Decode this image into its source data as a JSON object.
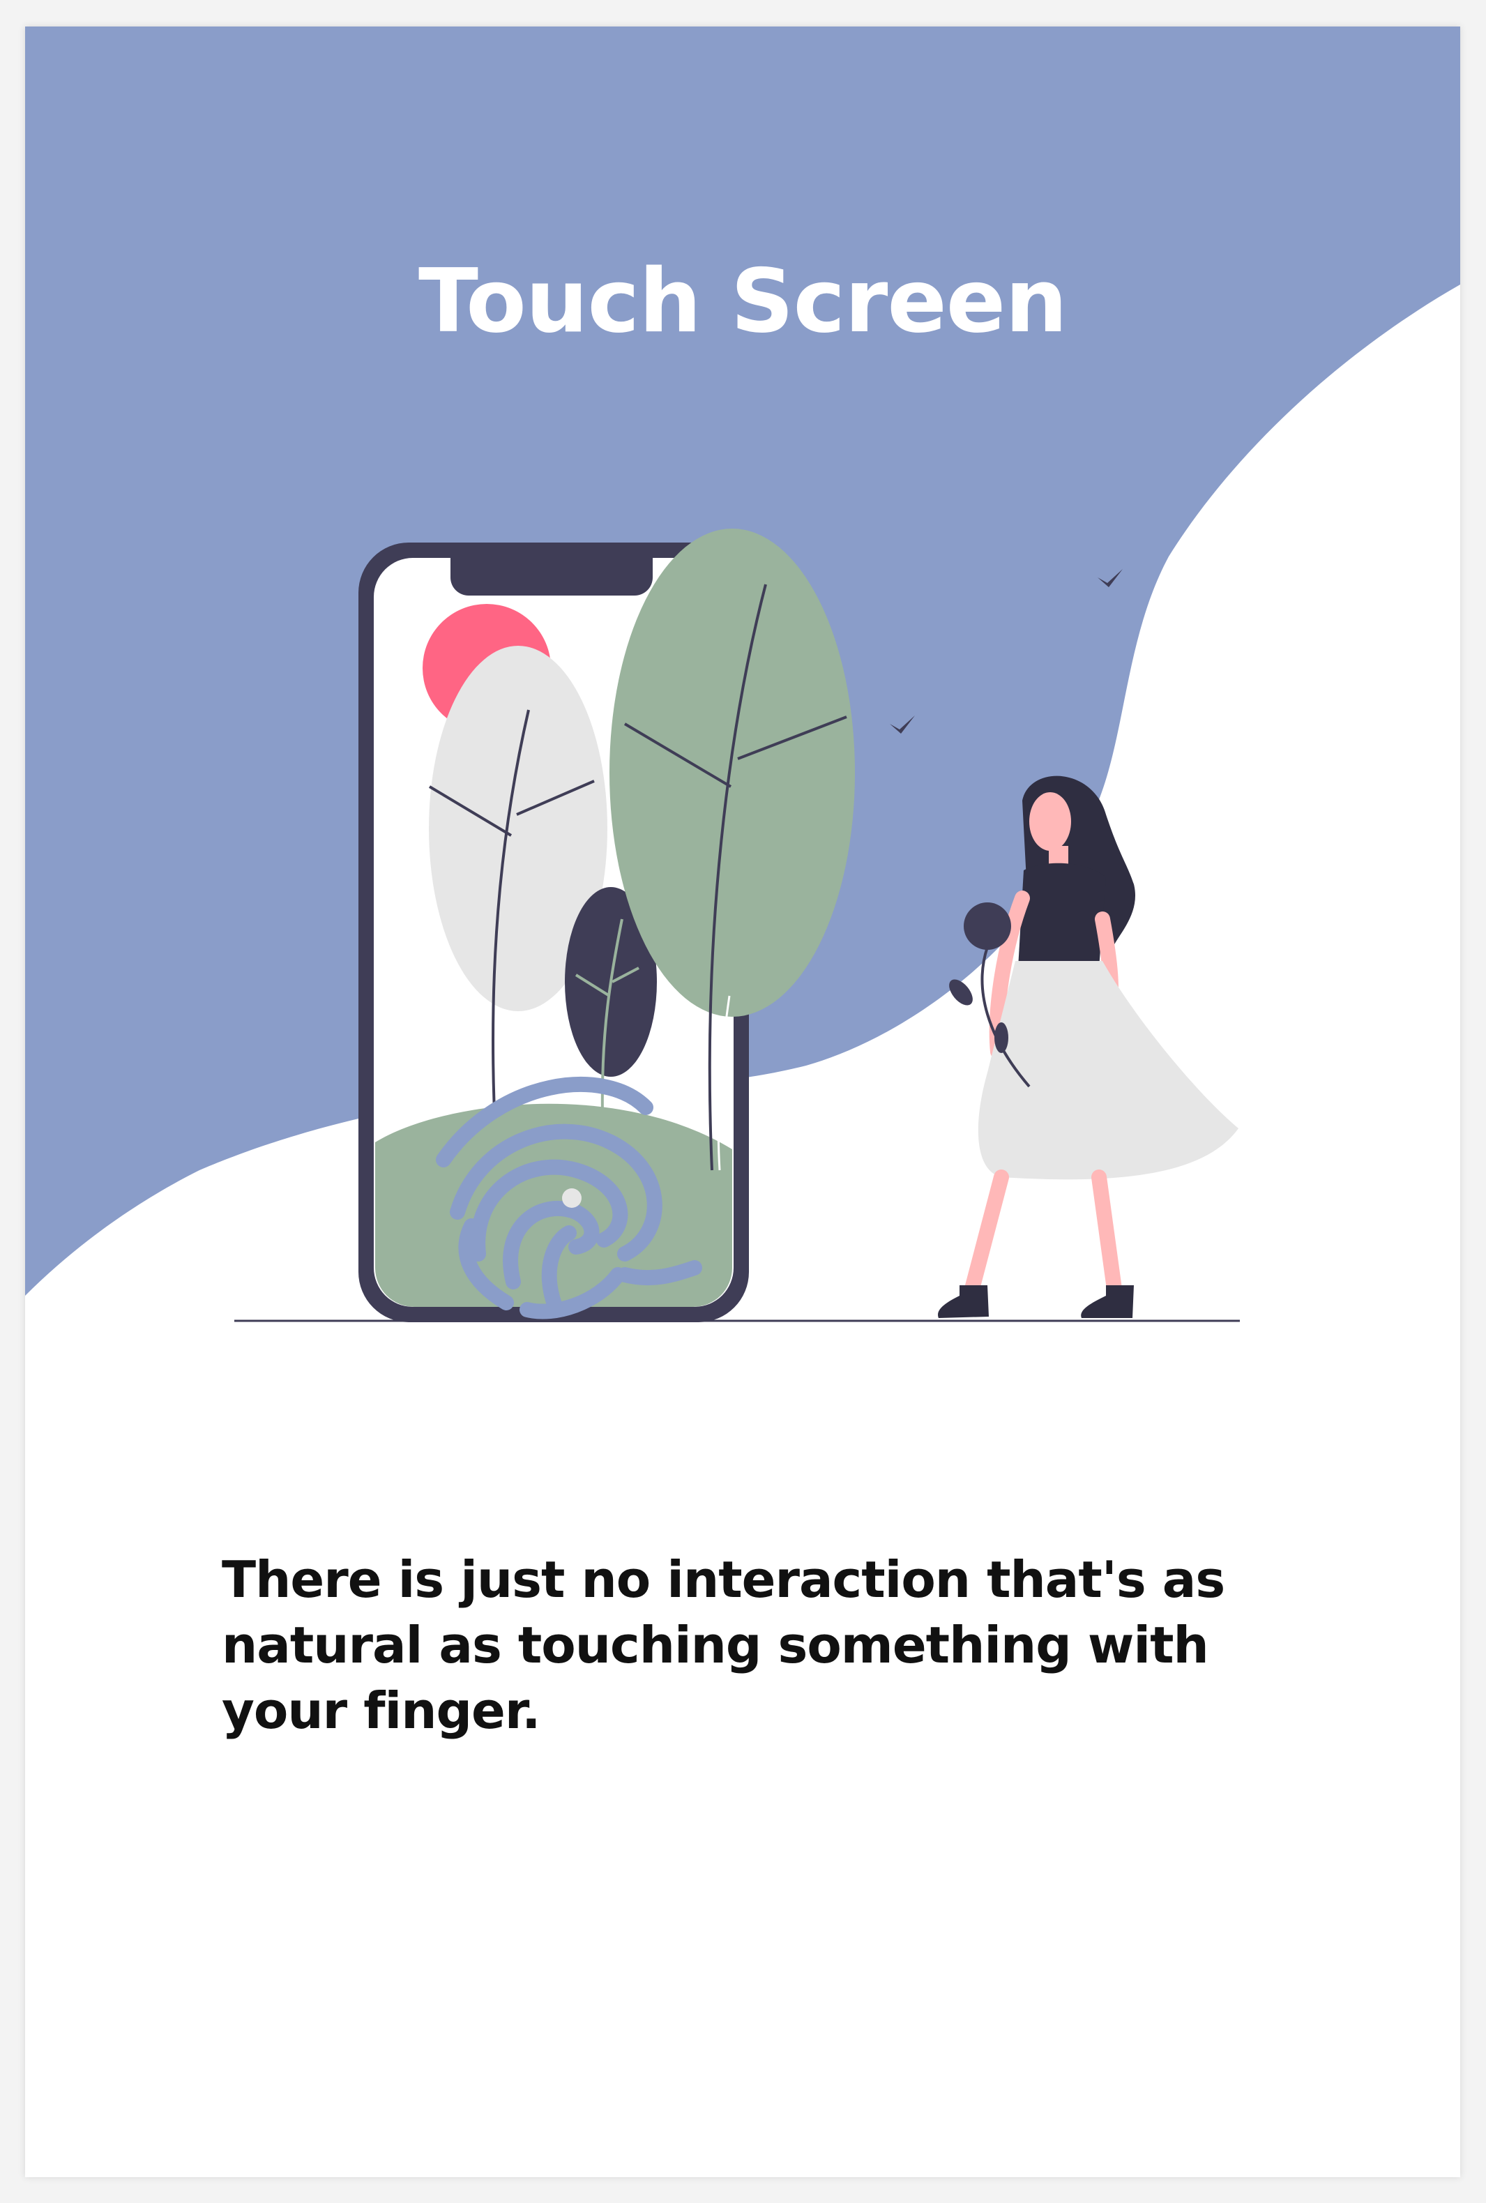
{
  "header": {
    "title": "Touch Screen"
  },
  "content": {
    "description": "There is just no interaction that's as natural as touching something with your finger."
  },
  "colors": {
    "header_blue": "#8a9dc9",
    "phone_frame": "#3f3d56",
    "sun_pink": "#ff6584",
    "leaf_green": "#9ab39d",
    "leaf_grey": "#e6e6e6",
    "skin": "#ffb8b8"
  },
  "icons": {
    "illustration": "woman-beside-phone-fingerprint"
  }
}
